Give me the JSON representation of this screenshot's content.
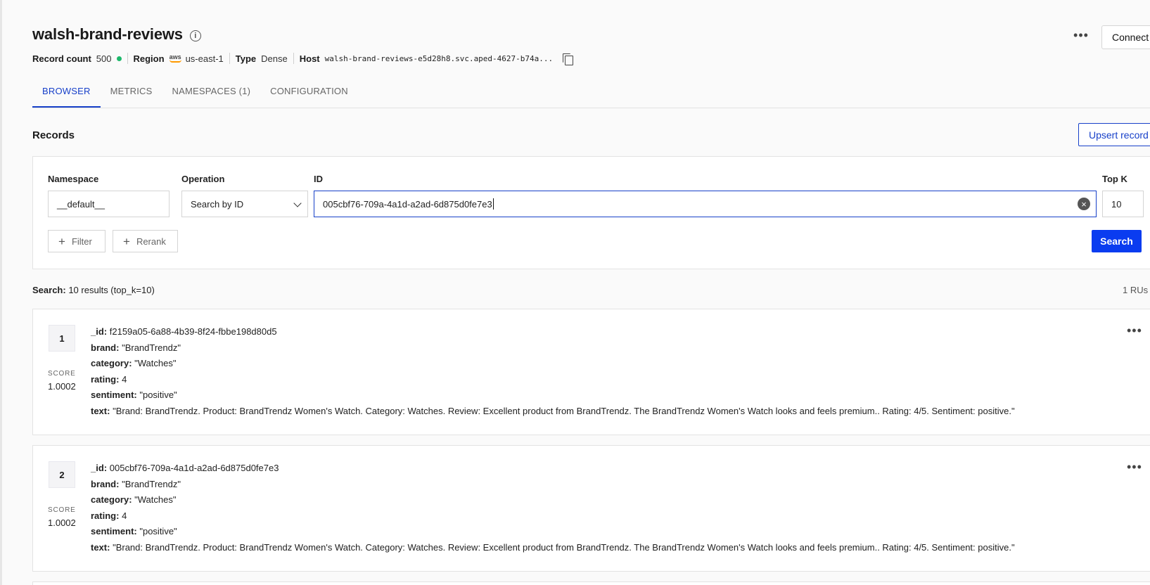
{
  "header": {
    "title": "walsh-brand-reviews",
    "record_count_label": "Record count",
    "record_count": "500",
    "region_label": "Region",
    "region_provider": "aws",
    "region": "us-east-1",
    "type_label": "Type",
    "type": "Dense",
    "host_label": "Host",
    "host": "walsh-brand-reviews-e5d28h8.svc.aped-4627-b74a...",
    "more_label": "•••",
    "connect_label": "Connect"
  },
  "tabs": [
    {
      "label": "BROWSER",
      "active": true
    },
    {
      "label": "METRICS",
      "active": false
    },
    {
      "label": "NAMESPACES (1)",
      "active": false
    },
    {
      "label": "CONFIGURATION",
      "active": false
    }
  ],
  "records": {
    "heading": "Records",
    "upsert_label": "Upsert record"
  },
  "query": {
    "namespace_label": "Namespace",
    "namespace_value": "__default__",
    "operation_label": "Operation",
    "operation_value": "Search by ID",
    "id_label": "ID",
    "id_value": "005cbf76-709a-4a1d-a2ad-6d875d0fe7e3",
    "topk_label": "Top K",
    "topk_value": "10",
    "filter_label": "Filter",
    "rerank_label": "Rerank",
    "search_label": "Search"
  },
  "summary": {
    "label": "Search:",
    "text": "10 results (top_k=10)",
    "rus": "1 RUs ("
  },
  "results": [
    {
      "rank": "1",
      "score_label": "SCORE",
      "score": "1.0002",
      "id_key": "_id:",
      "id": "f2159a05-6a88-4b39-8f24-fbbe198d80d5",
      "brand_key": "brand:",
      "brand": "\"BrandTrendz\"",
      "category_key": "category:",
      "category": "\"Watches\"",
      "rating_key": "rating:",
      "rating": "4",
      "sentiment_key": "sentiment:",
      "sentiment": "\"positive\"",
      "text_key": "text:",
      "text": "\"Brand: BrandTrendz. Product: BrandTrendz Women's Watch. Category: Watches. Review: Excellent product from BrandTrendz. The BrandTrendz Women's Watch looks and feels premium.. Rating: 4/5. Sentiment: positive.\""
    },
    {
      "rank": "2",
      "score_label": "SCORE",
      "score": "1.0002",
      "id_key": "_id:",
      "id": "005cbf76-709a-4a1d-a2ad-6d875d0fe7e3",
      "brand_key": "brand:",
      "brand": "\"BrandTrendz\"",
      "category_key": "category:",
      "category": "\"Watches\"",
      "rating_key": "rating:",
      "rating": "4",
      "sentiment_key": "sentiment:",
      "sentiment": "\"positive\"",
      "text_key": "text:",
      "text": "\"Brand: BrandTrendz. Product: BrandTrendz Women's Watch. Category: Watches. Review: Excellent product from BrandTrendz. The BrandTrendz Women's Watch looks and feels premium.. Rating: 4/5. Sentiment: positive.\""
    }
  ],
  "colors": {
    "accent": "#1740c9",
    "primary_button": "#0a3cf0",
    "status_dot": "#1db86b"
  }
}
